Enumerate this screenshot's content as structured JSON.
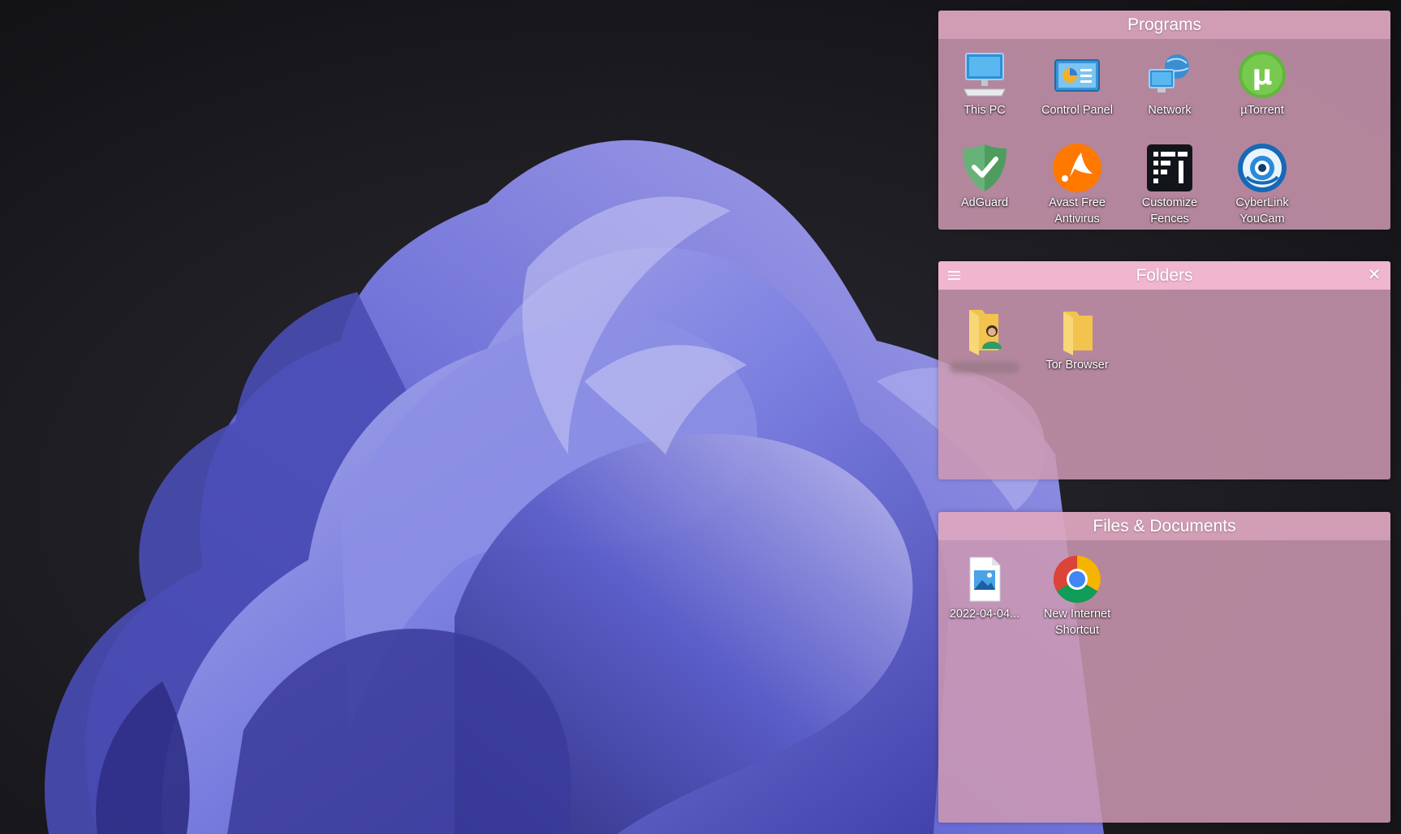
{
  "fences": [
    {
      "title": "Programs",
      "icons": [
        {
          "label": "This PC",
          "icon": "this-pc-icon"
        },
        {
          "label": "Control Panel",
          "icon": "control-panel-icon"
        },
        {
          "label": "Network",
          "icon": "network-icon"
        },
        {
          "label": "µTorrent",
          "icon": "utorrent-icon"
        },
        {
          "label": "AdGuard",
          "icon": "adguard-icon"
        },
        {
          "label": "Avast Free Antivirus",
          "icon": "avast-icon"
        },
        {
          "label": "Customize Fences",
          "icon": "customize-fences-icon"
        },
        {
          "label": "CyberLink YouCam",
          "icon": "youcam-icon"
        }
      ]
    },
    {
      "title": "Folders",
      "icons": [
        {
          "label": "",
          "icon": "user-folder-icon"
        },
        {
          "label": "Tor Browser",
          "icon": "folder-icon"
        }
      ]
    },
    {
      "title": "Files & Documents",
      "icons": [
        {
          "label": "2022-04-04...",
          "icon": "image-file-icon"
        },
        {
          "label": "New Internet Shortcut",
          "icon": "chrome-icon"
        }
      ]
    }
  ],
  "colors": {
    "fence_background": "#ce98b2",
    "fence_title_active": "#f0b6cf",
    "wallpaper_dark": "#161619",
    "wallpaper_bloom": "#6a6fd6"
  }
}
